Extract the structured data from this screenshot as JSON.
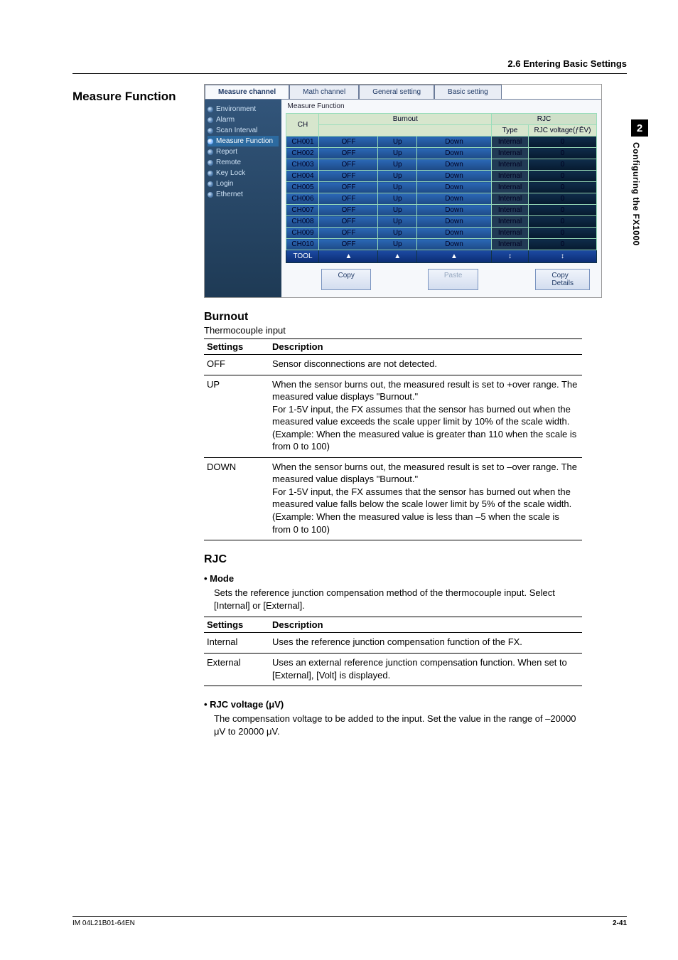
{
  "header": {
    "section": "2.6  Entering Basic Settings"
  },
  "title": "Measure Function",
  "sidetab": {
    "chapter": "2",
    "label": "Configuring the FX1000"
  },
  "footer": {
    "doc": "IM 04L21B01-64EN",
    "page": "2-41"
  },
  "shot": {
    "tabs": [
      "Measure channel",
      "Math channel",
      "General setting",
      "Basic setting"
    ],
    "active_tab": 0,
    "nav": [
      "Environment",
      "Alarm",
      "Scan Interval",
      "Measure Function",
      "Report",
      "Remote",
      "Key Lock",
      "Login",
      "Ethernet"
    ],
    "nav_selected": 3,
    "group_title": "Measure Function",
    "head": {
      "ch": "CH",
      "burnout": "Burnout",
      "rjc": "RJC",
      "type": "Type",
      "volt": "RJC voltage(ƒÊV)"
    },
    "rows": [
      {
        "ch": "CH001",
        "b1": "OFF",
        "b2": "Up",
        "b3": "Down",
        "t": "Internal",
        "v": "0"
      },
      {
        "ch": "CH002",
        "b1": "OFF",
        "b2": "Up",
        "b3": "Down",
        "t": "Internal",
        "v": "0"
      },
      {
        "ch": "CH003",
        "b1": "OFF",
        "b2": "Up",
        "b3": "Down",
        "t": "Internal",
        "v": "0"
      },
      {
        "ch": "CH004",
        "b1": "OFF",
        "b2": "Up",
        "b3": "Down",
        "t": "Internal",
        "v": "0"
      },
      {
        "ch": "CH005",
        "b1": "OFF",
        "b2": "Up",
        "b3": "Down",
        "t": "Internal",
        "v": "0"
      },
      {
        "ch": "CH006",
        "b1": "OFF",
        "b2": "Up",
        "b3": "Down",
        "t": "Internal",
        "v": "0"
      },
      {
        "ch": "CH007",
        "b1": "OFF",
        "b2": "Up",
        "b3": "Down",
        "t": "Internal",
        "v": "0"
      },
      {
        "ch": "CH008",
        "b1": "OFF",
        "b2": "Up",
        "b3": "Down",
        "t": "Internal",
        "v": "0"
      },
      {
        "ch": "CH009",
        "b1": "OFF",
        "b2": "Up",
        "b3": "Down",
        "t": "Internal",
        "v": "0"
      },
      {
        "ch": "CH010",
        "b1": "OFF",
        "b2": "Up",
        "b3": "Down",
        "t": "Internal",
        "v": "0"
      }
    ],
    "toolrow": {
      "label": "TOOL",
      "arrow": "▲",
      "dbl": "↕"
    },
    "buttons": {
      "copy": "Copy",
      "paste": "Paste",
      "details": "Copy Details"
    }
  },
  "burnout": {
    "heading": "Burnout",
    "sub": "Thermocouple input",
    "th": {
      "s": "Settings",
      "d": "Description"
    },
    "rows": [
      {
        "s": "OFF",
        "d": "Sensor disconnections are not detected."
      },
      {
        "s": "UP",
        "d": "When the sensor burns out, the measured result is set to +over range.  The measured value displays \"Burnout.\"\nFor 1-5V input, the FX assumes that the sensor has burned out when the measured value exceeds the scale upper limit by 10% of the scale width. (Example: When the measured value is greater than 110 when the scale is from 0 to 100)"
      },
      {
        "s": "DOWN",
        "d": "When the sensor burns out, the measured result is set to –over range.  The measured value displays \"Burnout.\"\nFor 1-5V input, the FX assumes that the sensor has burned out when the measured value falls below the scale lower limit by 5% of the scale width. (Example: When the measured value is less than –5 when the scale is from 0 to 100)"
      }
    ]
  },
  "rjc": {
    "heading": "RJC",
    "mode_h": "•  Mode",
    "mode_body": "Sets the reference junction compensation method of the thermocouple input.  Select [Internal] or [External].",
    "th": {
      "s": "Settings",
      "d": "Description"
    },
    "rows": [
      {
        "s": "Internal",
        "d": "Uses the reference junction compensation function of the FX."
      },
      {
        "s": "External",
        "d": "Uses an external reference junction compensation function.  When set to [External], [Volt] is displayed."
      }
    ],
    "volt_h": "•  RJC voltage (μV)",
    "volt_body": "The compensation voltage to be added to the input.  Set the value in the range of –20000 μV to 20000 μV."
  }
}
